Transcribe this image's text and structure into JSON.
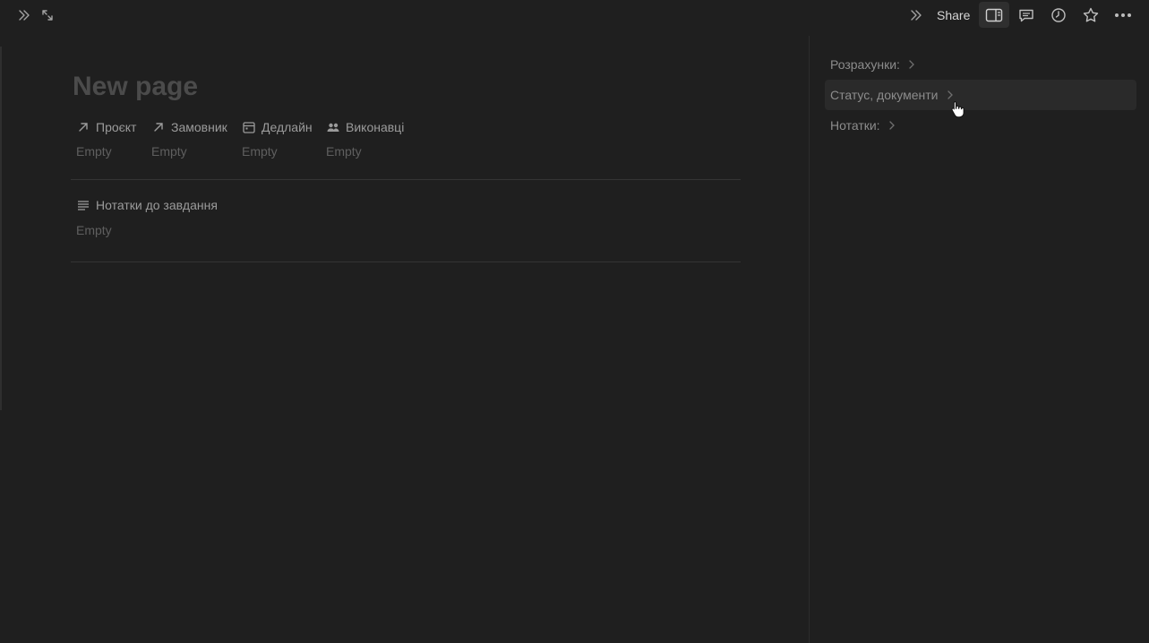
{
  "topbar": {
    "left_icons": [
      "double-chevron-right-icon",
      "expand-arrows-icon"
    ],
    "right_icons": [
      "double-chevron-right-icon",
      "side-panel-icon",
      "comment-icon",
      "history-clock-icon",
      "star-icon",
      "more-dots-icon"
    ],
    "share_label": "Share"
  },
  "page": {
    "title": "New page",
    "properties": [
      {
        "icon": "relation-arrow-icon",
        "label": "Проєкт",
        "value": "Empty"
      },
      {
        "icon": "relation-arrow-icon",
        "label": "Замовник",
        "value": "Empty"
      },
      {
        "icon": "calendar-icon",
        "label": "Дедлайн",
        "value": "Empty"
      },
      {
        "icon": "people-icon",
        "label": "Виконавці",
        "value": "Empty"
      }
    ],
    "notes": {
      "icon": "text-lines-icon",
      "label": "Нотатки до завдання",
      "value": "Empty"
    }
  },
  "panel": {
    "items": [
      {
        "label": "Розрахунки:"
      },
      {
        "label": "Статус, документи"
      },
      {
        "label": "Нотатки:"
      }
    ]
  },
  "colors": {
    "background": "#1f1f1f",
    "hover": "#2a2a2a",
    "text_muted": "#9b9b9b",
    "title": "#4b4b4b"
  }
}
